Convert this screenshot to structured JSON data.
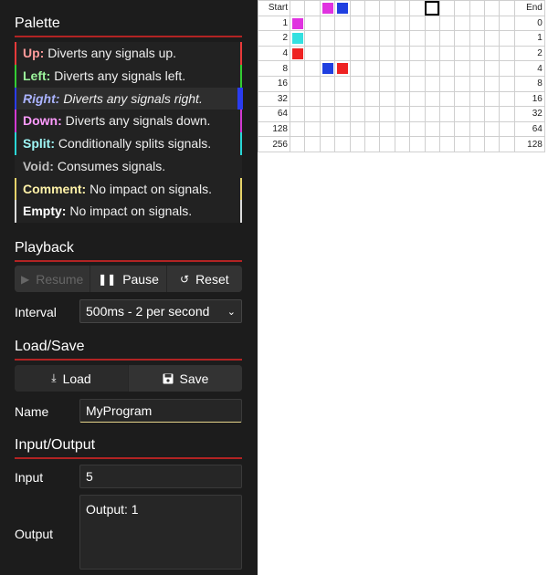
{
  "sections": {
    "palette": "Palette",
    "playback": "Playback",
    "loadsave": "Load/Save",
    "io": "Input/Output"
  },
  "palette": [
    {
      "name": "Up:",
      "desc": "Diverts any signals up.",
      "edge": "#e83a3a",
      "name_color": "#ff9b9b",
      "selected": false
    },
    {
      "name": "Left:",
      "desc": "Diverts any signals left.",
      "edge": "#33cc33",
      "name_color": "#9cf59c",
      "selected": false
    },
    {
      "name": "Right:",
      "desc": "Diverts any signals right.",
      "edge": "#2a3cf0",
      "name_color": "#aab3ff",
      "selected": true
    },
    {
      "name": "Down:",
      "desc": "Diverts any signals down.",
      "edge": "#d23ad2",
      "name_color": "#ff9bff",
      "selected": false
    },
    {
      "name": "Split:",
      "desc": "Conditionally splits signals.",
      "edge": "#2ad6d6",
      "name_color": "#9ff6f6",
      "selected": false
    },
    {
      "name": "Void:",
      "desc": "Consumes signals.",
      "edge": "#222222",
      "name_color": "#bdbdbd",
      "selected": false
    },
    {
      "name": "Comment:",
      "desc": "No impact on signals.",
      "edge": "#e6d36a",
      "name_color": "#fff2a8",
      "selected": false
    },
    {
      "name": "Empty:",
      "desc": "No impact on signals.",
      "edge": "#dddddd",
      "name_color": "#ffffff",
      "selected": false
    }
  ],
  "playback": {
    "resume": "Resume",
    "pause": "Pause",
    "reset": "Reset",
    "interval_label": "Interval",
    "interval_value": "500ms - 2 per second"
  },
  "loadsave": {
    "load": "Load",
    "save": "Save",
    "name_label": "Name",
    "name_value": "MyProgram"
  },
  "io": {
    "input_label": "Input",
    "input_value": "5",
    "output_label": "Output",
    "output_value": "Output: 1"
  },
  "grid": {
    "start_header": "Start",
    "end_header": "End",
    "columns": 15,
    "cursor": {
      "row": 0,
      "col": 9
    },
    "rows": [
      {
        "start": "",
        "end": "",
        "cells": {
          "2": "#e032e0",
          "3": "#1f3fe0"
        }
      },
      {
        "start": "1",
        "end": "0",
        "cells": {
          "0": "#e032e0"
        }
      },
      {
        "start": "2",
        "end": "1",
        "cells": {
          "0": "#34e0e0"
        }
      },
      {
        "start": "4",
        "end": "2",
        "cells": {
          "0": "#ee2222"
        }
      },
      {
        "start": "8",
        "end": "4",
        "cells": {
          "2": "#1f3fe0",
          "3": "#ee2222"
        }
      },
      {
        "start": "16",
        "end": "8",
        "cells": {}
      },
      {
        "start": "32",
        "end": "16",
        "cells": {}
      },
      {
        "start": "64",
        "end": "32",
        "cells": {}
      },
      {
        "start": "128",
        "end": "64",
        "cells": {}
      },
      {
        "start": "256",
        "end": "128",
        "cells": {}
      }
    ]
  }
}
